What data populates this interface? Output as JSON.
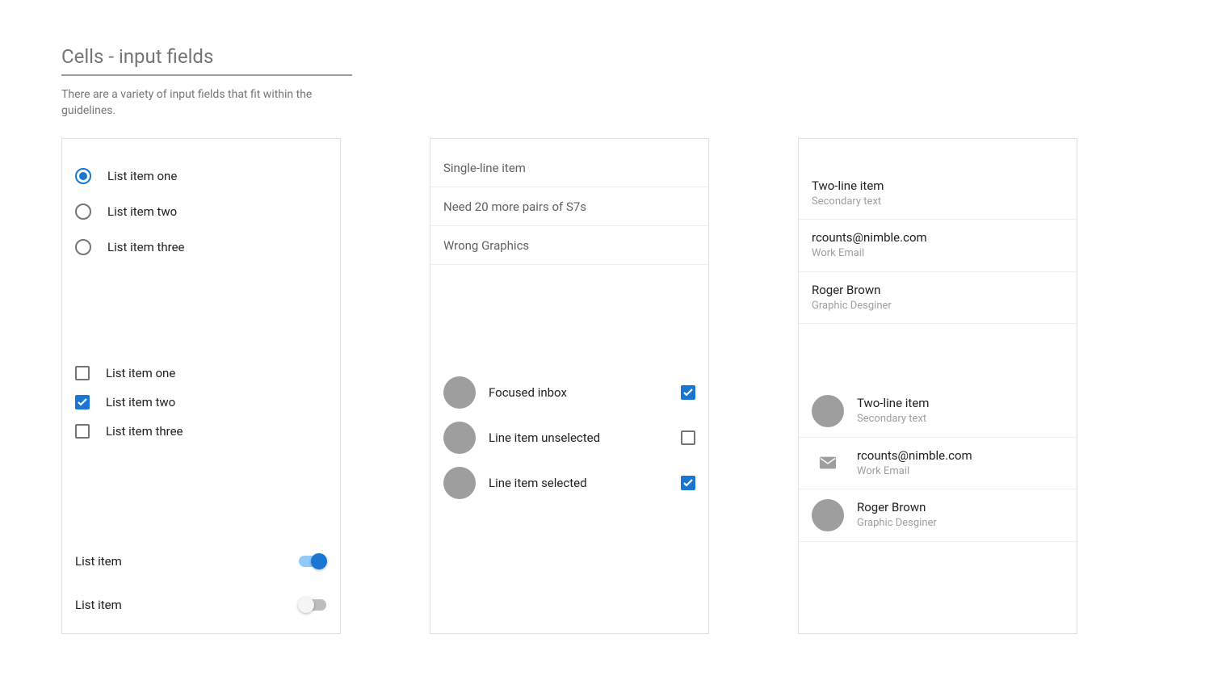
{
  "title": "Cells - input fields",
  "description": "There are a variety of input fields that fit within the guidelines.",
  "card1": {
    "radios": [
      {
        "label": "List item one"
      },
      {
        "label": "List item two"
      },
      {
        "label": "List item three"
      }
    ],
    "checkboxes": [
      {
        "label": "List item one"
      },
      {
        "label": "List item two"
      },
      {
        "label": "List item three"
      }
    ],
    "switches": [
      {
        "label": "List item"
      },
      {
        "label": "List item"
      }
    ]
  },
  "card2": {
    "single_items": [
      "Single-line item",
      "Need 20 more pairs of S7s",
      "Wrong Graphics"
    ],
    "avatar_items": [
      {
        "label": "Focused inbox"
      },
      {
        "label": "Line item unselected"
      },
      {
        "label": "Line item selected"
      }
    ]
  },
  "card3": {
    "top_items": [
      {
        "primary": "Two-line item",
        "secondary": "Secondary text"
      },
      {
        "primary": "rcounts@nimble.com",
        "secondary": "Work Email"
      },
      {
        "primary": "Roger Brown",
        "secondary": "Graphic Desginer"
      }
    ],
    "icon_items": [
      {
        "primary": "Two-line item",
        "secondary": "Secondary text"
      },
      {
        "primary": "rcounts@nimble.com",
        "secondary": "Work Email"
      },
      {
        "primary": "Roger Brown",
        "secondary": "Graphic Desginer"
      }
    ]
  }
}
